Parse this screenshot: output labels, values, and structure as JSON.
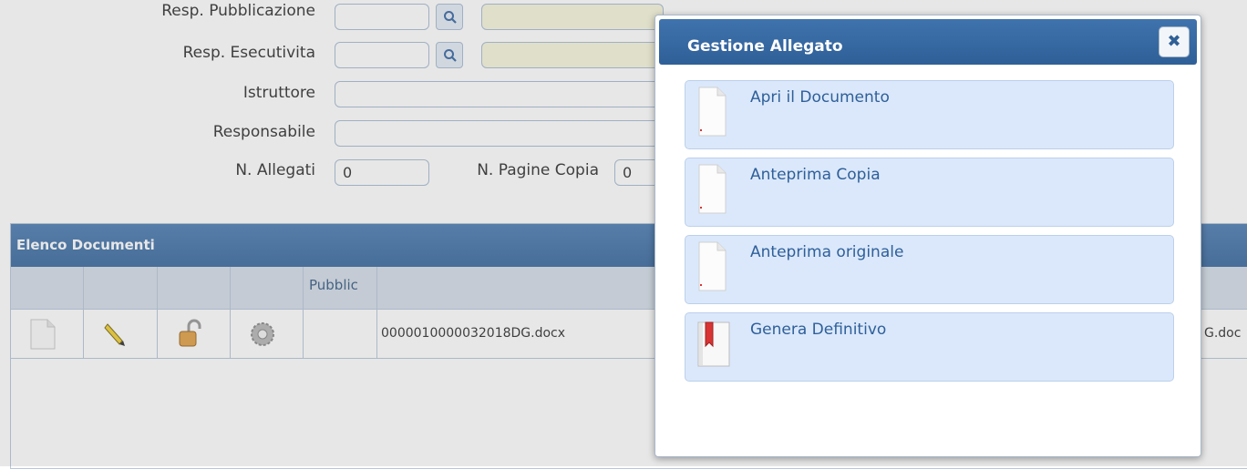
{
  "form": {
    "resp_pubblicazione_label": "Resp. Pubblicazione",
    "resp_esecutivita_label": "Resp. Esecutivita",
    "istruttore_label": "Istruttore",
    "responsabile_label": "Responsabile",
    "n_allegati_label": "N. Allegati",
    "n_allegati_value": "0",
    "n_pagine_copia_label": "N. Pagine Copia",
    "n_pagine_copia_value": "0"
  },
  "documents_panel": {
    "title": "Elenco Documenti",
    "columns": [
      "",
      "",
      "",
      "",
      "Pubblic",
      ""
    ],
    "rows": [
      {
        "filename": "0000010000032018DG.docx",
        "right_text": "G.doc"
      }
    ]
  },
  "dialog": {
    "title": "Gestione Allegato",
    "close_icon": "✖",
    "items": [
      {
        "label": "Apri il Documento",
        "icon": "document-icon"
      },
      {
        "label": "Anteprima Copia",
        "icon": "document-icon"
      },
      {
        "label": "Anteprima originale",
        "icon": "document-icon"
      },
      {
        "label": "Genera Definitivo",
        "icon": "bookmark-book-icon"
      }
    ]
  },
  "colors": {
    "header_blue": "#3f73ad",
    "menu_item_bg": "#dbe8fb",
    "link_text": "#2e5f99"
  }
}
